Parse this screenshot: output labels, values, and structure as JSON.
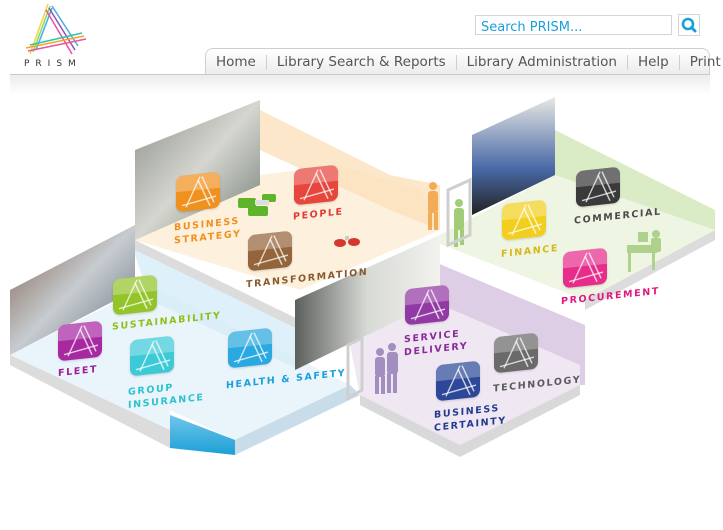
{
  "header": {
    "logo_text": "PRISM",
    "search": {
      "placeholder": "Search PRISM...",
      "value": ""
    },
    "search_button_icon": "search-icon"
  },
  "nav": {
    "items": [
      {
        "label": "Home"
      },
      {
        "label": "Library Search & Reports"
      },
      {
        "label": "Library Administration"
      },
      {
        "label": "Help"
      },
      {
        "label": "Print"
      }
    ]
  },
  "map": {
    "zones": [
      {
        "key": "business-strategy",
        "lines": [
          "BUSINESS",
          "STRATEGY"
        ],
        "color": "#f0901e"
      },
      {
        "key": "people",
        "lines": [
          "PEOPLE"
        ],
        "color": "#e23a36"
      },
      {
        "key": "transformation",
        "lines": [
          "TRANSFORMATION"
        ],
        "color": "#8a5a2e"
      },
      {
        "key": "finance",
        "lines": [
          "FINANCE"
        ],
        "color": "#d9b71a"
      },
      {
        "key": "commercial",
        "lines": [
          "COMMERCIAL"
        ],
        "color": "#4a4a4a"
      },
      {
        "key": "procurement",
        "lines": [
          "PROCUREMENT"
        ],
        "color": "#e0197f"
      },
      {
        "key": "sustainability",
        "lines": [
          "SUSTAINABILITY"
        ],
        "color": "#8fbf1a"
      },
      {
        "key": "fleet",
        "lines": [
          "FLEET"
        ],
        "color": "#a01a9a"
      },
      {
        "key": "group-insurance",
        "lines": [
          "GROUP",
          "INSURANCE"
        ],
        "color": "#2cc2cf"
      },
      {
        "key": "health-safety",
        "lines": [
          "HEALTH & SAFETY"
        ],
        "color": "#1a9fdc"
      },
      {
        "key": "service-delivery",
        "lines": [
          "SERVICE",
          "DELIVERY"
        ],
        "color": "#8a2a9a"
      },
      {
        "key": "business-certainty",
        "lines": [
          "BUSINESS",
          "CERTAINTY"
        ],
        "color": "#233a8e"
      },
      {
        "key": "technology",
        "lines": [
          "TECHNOLOGY"
        ],
        "color": "#5a5a5a"
      }
    ]
  }
}
